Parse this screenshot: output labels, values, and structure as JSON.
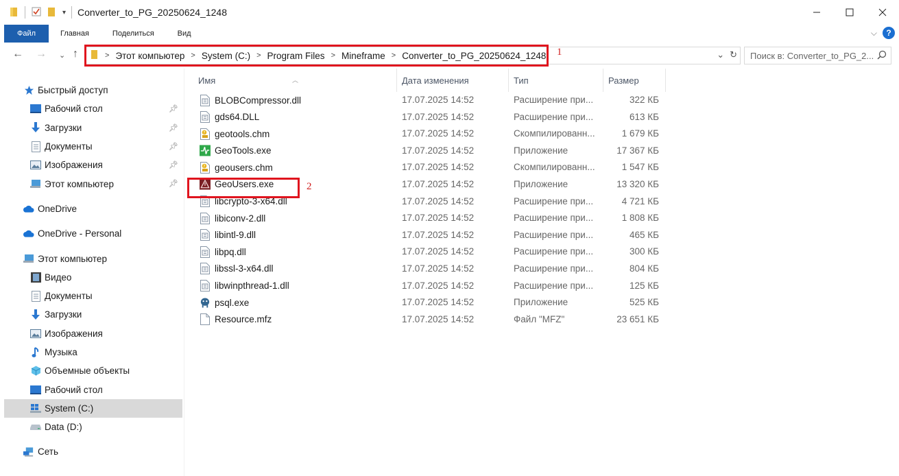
{
  "window": {
    "title": "Converter_to_PG_20250624_1248"
  },
  "ribbon": {
    "tabs": [
      "Файл",
      "Главная",
      "Поделиться",
      "Вид"
    ]
  },
  "address": {
    "crumbs": [
      "Этот компьютер",
      "System (C:)",
      "Program Files",
      "Mineframe",
      "Converter_to_PG_20250624_1248"
    ]
  },
  "search": {
    "placeholder": "Поиск в: Converter_to_PG_2..."
  },
  "annotations": {
    "one": "1",
    "two": "2"
  },
  "sidebar": {
    "quick_access": "Быстрый доступ",
    "pinned": [
      "Рабочий стол",
      "Загрузки",
      "Документы",
      "Изображения",
      "Этот компьютер"
    ],
    "onedrive": "OneDrive",
    "onedrive_personal": "OneDrive - Personal",
    "this_pc": "Этот компьютер",
    "pc_items": [
      "Видео",
      "Документы",
      "Загрузки",
      "Изображения",
      "Музыка",
      "Объемные объекты",
      "Рабочий стол",
      "System (C:)",
      "Data (D:)"
    ],
    "network": "Сеть"
  },
  "columns": {
    "name": "Имя",
    "date": "Дата изменения",
    "type": "Тип",
    "size": "Размер"
  },
  "files": [
    {
      "name": "BLOBCompressor.dll",
      "date": "17.07.2025 14:52",
      "type": "Расширение при...",
      "size": "322 КБ",
      "icon": "dll-icon"
    },
    {
      "name": "gds64.DLL",
      "date": "17.07.2025 14:52",
      "type": "Расширение при...",
      "size": "613 КБ",
      "icon": "dll-icon"
    },
    {
      "name": "geotools.chm",
      "date": "17.07.2025 14:52",
      "type": "Скомпилированн...",
      "size": "1 679 КБ",
      "icon": "chm-icon"
    },
    {
      "name": "GeoTools.exe",
      "date": "17.07.2025 14:52",
      "type": "Приложение",
      "size": "17 367 КБ",
      "icon": "geotools-icon"
    },
    {
      "name": "geousers.chm",
      "date": "17.07.2025 14:52",
      "type": "Скомпилированн...",
      "size": "1 547 КБ",
      "icon": "chm-icon"
    },
    {
      "name": "GeoUsers.exe",
      "date": "17.07.2025 14:52",
      "type": "Приложение",
      "size": "13 320 КБ",
      "icon": "geousers-icon"
    },
    {
      "name": "libcrypto-3-x64.dll",
      "date": "17.07.2025 14:52",
      "type": "Расширение при...",
      "size": "4 721 КБ",
      "icon": "dll-icon"
    },
    {
      "name": "libiconv-2.dll",
      "date": "17.07.2025 14:52",
      "type": "Расширение при...",
      "size": "1 808 КБ",
      "icon": "dll-icon"
    },
    {
      "name": "libintl-9.dll",
      "date": "17.07.2025 14:52",
      "type": "Расширение при...",
      "size": "465 КБ",
      "icon": "dll-icon"
    },
    {
      "name": "libpq.dll",
      "date": "17.07.2025 14:52",
      "type": "Расширение при...",
      "size": "300 КБ",
      "icon": "dll-icon"
    },
    {
      "name": "libssl-3-x64.dll",
      "date": "17.07.2025 14:52",
      "type": "Расширение при...",
      "size": "804 КБ",
      "icon": "dll-icon"
    },
    {
      "name": "libwinpthread-1.dll",
      "date": "17.07.2025 14:52",
      "type": "Расширение при...",
      "size": "125 КБ",
      "icon": "dll-icon"
    },
    {
      "name": "psql.exe",
      "date": "17.07.2025 14:52",
      "type": "Приложение",
      "size": "525 КБ",
      "icon": "postgres-icon"
    },
    {
      "name": "Resource.mfz",
      "date": "17.07.2025 14:52",
      "type": "Файл \"MFZ\"",
      "size": "23 651 КБ",
      "icon": "blank-file-icon"
    }
  ],
  "colors": {
    "accent": "#1d5fae",
    "highlight": "#e0141e",
    "selected": "#d9d9d9"
  }
}
